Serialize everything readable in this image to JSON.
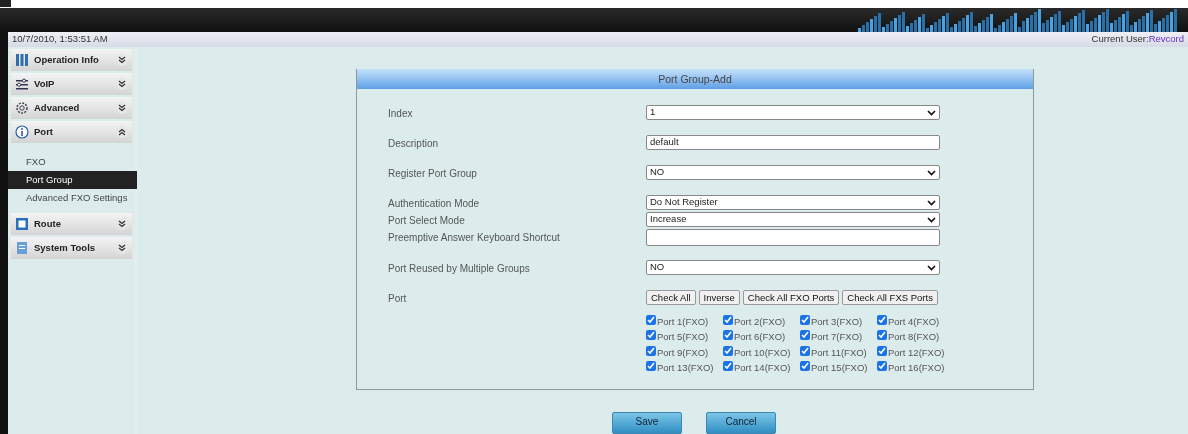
{
  "header": {
    "datetime": "10/7/2010, 1:53:51 AM",
    "user_label": "Current User:",
    "user_name": "Revcord"
  },
  "sidebar": [
    {
      "label": "Operation Info",
      "expanded": false
    },
    {
      "label": "VoIP",
      "expanded": false
    },
    {
      "label": "Advanced",
      "expanded": false
    },
    {
      "label": "Port",
      "expanded": true,
      "children": [
        {
          "label": "FXO",
          "selected": false
        },
        {
          "label": "Port Group",
          "selected": true
        },
        {
          "label": "Advanced FXO Settings",
          "selected": false
        }
      ]
    },
    {
      "label": "Route",
      "expanded": false
    },
    {
      "label": "System Tools",
      "expanded": false
    }
  ],
  "form": {
    "title": "Port Group-Add",
    "fields": [
      {
        "label": "Index",
        "kind": "select",
        "value": "1"
      },
      {
        "label": "Description",
        "kind": "text",
        "value": "default"
      },
      {
        "label": "Register Port Group",
        "kind": "select",
        "value": "NO"
      },
      {
        "label": "Authentication Mode",
        "kind": "select",
        "value": "Do Not Register"
      },
      {
        "label": "Port Select Mode",
        "kind": "select",
        "value": "Increase"
      },
      {
        "label": "Preemptive Answer Keyboard Shortcut",
        "kind": "text"
      },
      {
        "label": "Port Reused by Multiple Groups",
        "kind": "select",
        "value": "NO"
      }
    ],
    "port_label": "Port",
    "port_buttons": [
      "Check All",
      "Inverse",
      "Check All FXO Ports",
      "Check All FXS Ports"
    ],
    "ports": [
      {
        "label": "Port 1(FXO)",
        "checked": true
      },
      {
        "label": "Port 2(FXO)",
        "checked": true
      },
      {
        "label": "Port 3(FXO)",
        "checked": true
      },
      {
        "label": "Port 4(FXO)",
        "checked": true
      },
      {
        "label": "Port 5(FXO)",
        "checked": true
      },
      {
        "label": "Port 6(FXO)",
        "checked": true
      },
      {
        "label": "Port 7(FXO)",
        "checked": true
      },
      {
        "label": "Port 8(FXO)",
        "checked": true
      },
      {
        "label": "Port 9(FXO)",
        "checked": true
      },
      {
        "label": "Port 10(FXO)",
        "checked": true
      },
      {
        "label": "Port 11(FXO)",
        "checked": true
      },
      {
        "label": "Port 12(FXO)",
        "checked": true
      },
      {
        "label": "Port 13(FXO)",
        "checked": true
      },
      {
        "label": "Port 14(FXO)",
        "checked": true
      },
      {
        "label": "Port 15(FXO)",
        "checked": true
      },
      {
        "label": "Port 16(FXO)",
        "checked": true
      }
    ]
  },
  "actions": [
    "Save",
    "Cancel"
  ]
}
